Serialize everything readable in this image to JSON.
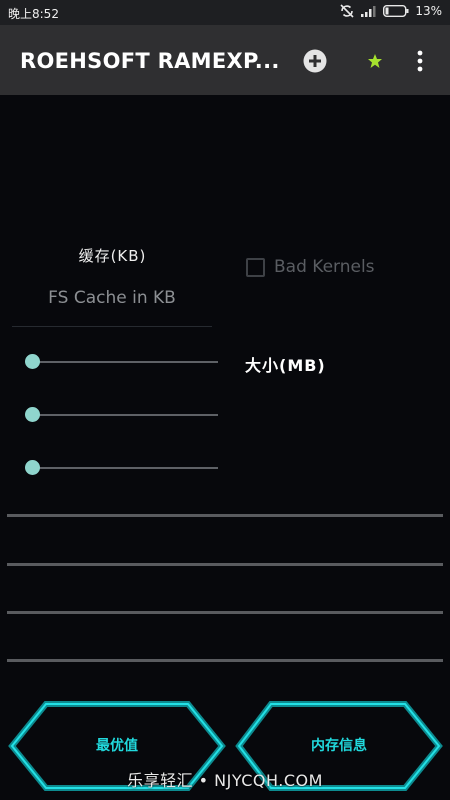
{
  "status_bar": {
    "time": "晚上8:52",
    "battery": "13%"
  },
  "app_bar": {
    "title": "ROEHSOFT RAMEXP...",
    "actions": {
      "add_icon": "add-circle-icon",
      "star_icon": "star-icon",
      "menu_icon": "more-vertical-icon"
    }
  },
  "cache": {
    "label": "缓存(KB)",
    "placeholder": "FS Cache in KB"
  },
  "bad_kernels": {
    "label": "Bad Kernels",
    "checked": false
  },
  "size_label": "大小(MB)",
  "sliders": [
    {
      "value": 0
    },
    {
      "value": 0
    },
    {
      "value": 0
    }
  ],
  "buttons": {
    "optimal": "最优值",
    "memory_info": "内存信息"
  },
  "watermark": "乐享轻汇 • NJYCQH.COM",
  "colors": {
    "accent": "#21d9dd",
    "slider_thumb": "#8fd5cd",
    "star": "#a6e22e"
  }
}
